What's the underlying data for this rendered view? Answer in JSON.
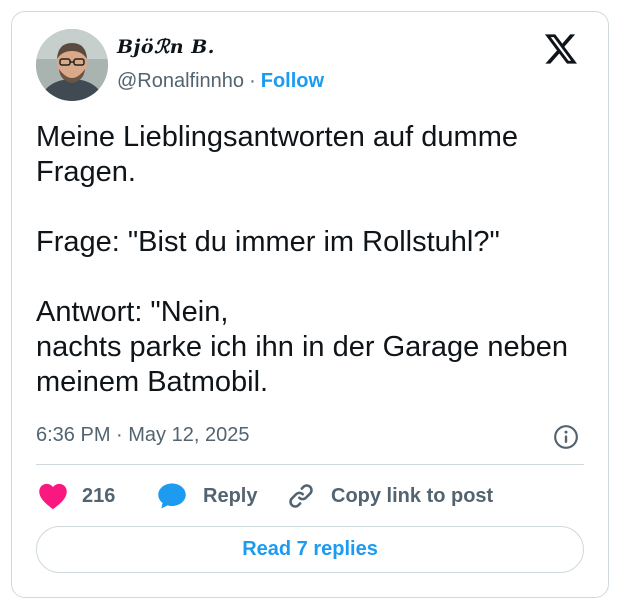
{
  "author": {
    "display_name": "Bjöℛn B.",
    "handle": "@Ronalfinnho",
    "separator": "·",
    "follow_label": "Follow"
  },
  "tweet": {
    "text": "Meine Lieblingsantworten auf dumme Fragen.\n\nFrage: \"Bist du immer im Rollstuhl?\"\n\nAntwort: \"Nein,\nnachts parke ich ihn in der Garage neben meinem Batmobil.",
    "timestamp": "6:36 PM · May 12, 2025"
  },
  "actions": {
    "like_count": "216",
    "reply_label": "Reply",
    "copy_link_label": "Copy link to post",
    "read_replies_label": "Read 7 replies"
  },
  "icons": {
    "brand": "x-logo-icon",
    "info": "info-icon",
    "like": "heart-icon",
    "reply": "speech-bubble-icon",
    "copy": "link-icon"
  },
  "colors": {
    "accent": "#1d9bf0",
    "like": "#f91880",
    "text": "#0f1419",
    "muted": "#536471",
    "border": "#cfd9de"
  }
}
